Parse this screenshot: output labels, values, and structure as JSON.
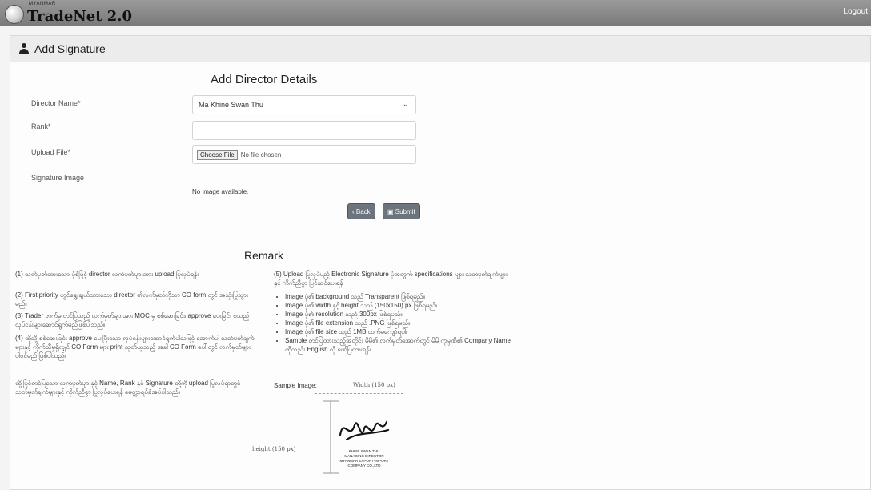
{
  "app": {
    "brand_small": "MYANMAR",
    "brand_name": "TradeNet 2.0",
    "logout": "Logout"
  },
  "page": {
    "header_title": "Add Signature",
    "form_title": "Add Director Details"
  },
  "form": {
    "director_label": "Director Name*",
    "director_value": "Ma Khine Swan Thu",
    "rank_label": "Rank*",
    "rank_value": "",
    "upload_label": "Upload File*",
    "choose_file": "Choose File",
    "no_file": "No file chosen",
    "signature_label": "Signature Image",
    "no_image": "No image available.",
    "back": "Back",
    "submit": "Submit"
  },
  "remark": {
    "title": "Remark",
    "left": [
      "(1) သတ်မှတ်ထားသော ပုံစံဖြင့် director လက်မှတ်များအား upload ပြုလုပ်ရန်။",
      "(2) First priority တွင်ရွေးချယ်ထားသော director ၏လက်မှတ်ကိုသာ CO form တွင် အသုံးပြုသွားမည်။",
      "(3) Trader ဘက်မှ တင်ပြသည့် လက်မှတ်များအား MOC မှ စစ်ဆေးခြင်း၊ approve ပေးခြင်း စသည့် လုပ်ငန်းများဆောင်ရွက်မည်ဖြစ်ပါသည်။",
      "(4) ထိုသို့ စစ်ဆေးခြင်း approve ပေးပြီးသော လုပ်ငန်းများဆောင်ရွက်ပါသဖြင့် အောက်ပါ သတ်မှတ်ချက်များနှင့် ကိုက်ညီမှုရှိလျှင် CO Form များ print ထုတ်ယူသည့် အခါ CO Form ပေါ်တွင် လက်မှတ်များ ပါဝင်မည် ဖြစ်ပါသည်။",
      "ထို့ပြင်တင်ပြသော လက်မှတ်များနှင့် Name, Rank နှင့် Signature တို့ကို upload ပြုလုပ်ရာတွင် သတ်မှတ်ချက်များနှင့် ကိုက်ညီစွာ ပြုလုပ်ပေးရန် မေတ္တာရပ်ခံအပ်ပါသည်။"
    ],
    "right_intro": "(5) Upload ပြုလုပ်မည့် Electronic Signature ပုံအတွက် specifications များ သတ်မှတ်ချက်များနှင့် ကိုက်ညီစွာ ပြင်ဆင်ပေးရန်",
    "bullets": [
      "Image ပုံ၏ background သည် Transparent ဖြစ်ရမည်။",
      "Image ပုံ၏ width နှင့် height သည် (150x150) px ဖြစ်ရမည်။",
      "Image ပုံ၏ resolution သည် 300px ဖြစ်ရမည်။",
      "Image ပုံ၏ file extension သည် .PNG ဖြစ်ရမည်။",
      "Image ပုံ၏ file size သည် 1MB ထက်မကျော်ရပါ။",
      "Sample တင်ပြထားသည့်အတိုင်း မိမိ၏ လက်မှတ်အောက်တွင် မိမိ ကုမ္ပဏီ၏ Company Name ကိုလည်း English လို ဖော်ပြထားရန်။"
    ],
    "sample_label": "Sample Image:",
    "width_label": "Width (150 px)",
    "height_label": "height (150 px)",
    "stamp_lines": [
      "KHINE SWAN THU",
      "MANAGING DIRECTOR",
      "MYANMAR EXPORT-IMPORT",
      "COMPANY CO.,LTD"
    ]
  }
}
